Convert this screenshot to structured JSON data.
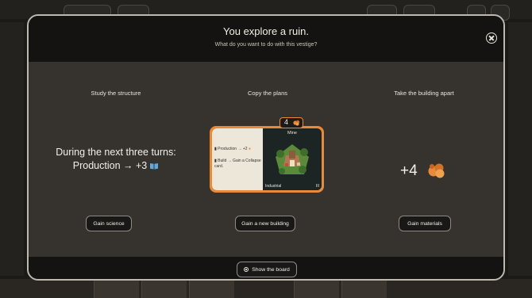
{
  "modal": {
    "title": "You explore a ruin.",
    "subtitle": "What do you want to do with this vestige?"
  },
  "options": [
    {
      "heading": "Study the structure",
      "effect_line1": "During the next three turns:",
      "effect_line2": "Production → +3",
      "effect_icon": "book-icon",
      "button": "Gain science"
    },
    {
      "heading": "Copy the plans",
      "button": "Gain a new building",
      "card": {
        "cost": "4",
        "cost_icon": "materials-icon",
        "name": "Mine",
        "production_label": "Production",
        "production_value": "→ +2",
        "build_label": "Build",
        "build_text": "→ Gain a Collapse card.",
        "type": "Industrial",
        "level": "III"
      }
    },
    {
      "heading": "Take the building apart",
      "effect": "+4",
      "effect_icon": "materials-icon",
      "button": "Gain materials"
    }
  ],
  "footer": {
    "show_board": "Show the board"
  },
  "colors": {
    "accent": "#e98a3a",
    "science": "#5fa8e0",
    "header": "#141311",
    "panel": "#36332f"
  }
}
